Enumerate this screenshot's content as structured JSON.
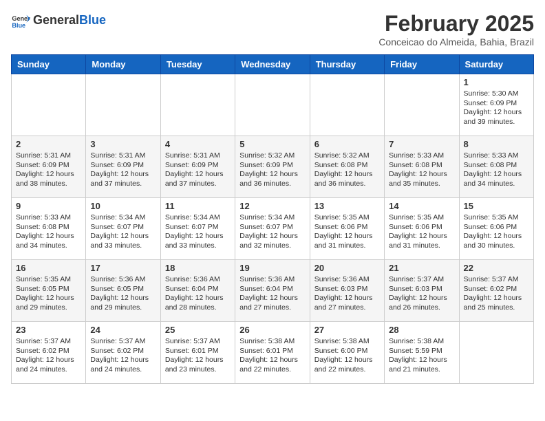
{
  "header": {
    "logo_general": "General",
    "logo_blue": "Blue",
    "month_title": "February 2025",
    "location": "Conceicao do Almeida, Bahia, Brazil"
  },
  "days_of_week": [
    "Sunday",
    "Monday",
    "Tuesday",
    "Wednesday",
    "Thursday",
    "Friday",
    "Saturday"
  ],
  "weeks": [
    [
      {
        "day": "",
        "info": ""
      },
      {
        "day": "",
        "info": ""
      },
      {
        "day": "",
        "info": ""
      },
      {
        "day": "",
        "info": ""
      },
      {
        "day": "",
        "info": ""
      },
      {
        "day": "",
        "info": ""
      },
      {
        "day": "1",
        "info": "Sunrise: 5:30 AM\nSunset: 6:09 PM\nDaylight: 12 hours and 39 minutes."
      }
    ],
    [
      {
        "day": "2",
        "info": "Sunrise: 5:31 AM\nSunset: 6:09 PM\nDaylight: 12 hours and 38 minutes."
      },
      {
        "day": "3",
        "info": "Sunrise: 5:31 AM\nSunset: 6:09 PM\nDaylight: 12 hours and 37 minutes."
      },
      {
        "day": "4",
        "info": "Sunrise: 5:31 AM\nSunset: 6:09 PM\nDaylight: 12 hours and 37 minutes."
      },
      {
        "day": "5",
        "info": "Sunrise: 5:32 AM\nSunset: 6:09 PM\nDaylight: 12 hours and 36 minutes."
      },
      {
        "day": "6",
        "info": "Sunrise: 5:32 AM\nSunset: 6:08 PM\nDaylight: 12 hours and 36 minutes."
      },
      {
        "day": "7",
        "info": "Sunrise: 5:33 AM\nSunset: 6:08 PM\nDaylight: 12 hours and 35 minutes."
      },
      {
        "day": "8",
        "info": "Sunrise: 5:33 AM\nSunset: 6:08 PM\nDaylight: 12 hours and 34 minutes."
      }
    ],
    [
      {
        "day": "9",
        "info": "Sunrise: 5:33 AM\nSunset: 6:08 PM\nDaylight: 12 hours and 34 minutes."
      },
      {
        "day": "10",
        "info": "Sunrise: 5:34 AM\nSunset: 6:07 PM\nDaylight: 12 hours and 33 minutes."
      },
      {
        "day": "11",
        "info": "Sunrise: 5:34 AM\nSunset: 6:07 PM\nDaylight: 12 hours and 33 minutes."
      },
      {
        "day": "12",
        "info": "Sunrise: 5:34 AM\nSunset: 6:07 PM\nDaylight: 12 hours and 32 minutes."
      },
      {
        "day": "13",
        "info": "Sunrise: 5:35 AM\nSunset: 6:06 PM\nDaylight: 12 hours and 31 minutes."
      },
      {
        "day": "14",
        "info": "Sunrise: 5:35 AM\nSunset: 6:06 PM\nDaylight: 12 hours and 31 minutes."
      },
      {
        "day": "15",
        "info": "Sunrise: 5:35 AM\nSunset: 6:06 PM\nDaylight: 12 hours and 30 minutes."
      }
    ],
    [
      {
        "day": "16",
        "info": "Sunrise: 5:35 AM\nSunset: 6:05 PM\nDaylight: 12 hours and 29 minutes."
      },
      {
        "day": "17",
        "info": "Sunrise: 5:36 AM\nSunset: 6:05 PM\nDaylight: 12 hours and 29 minutes."
      },
      {
        "day": "18",
        "info": "Sunrise: 5:36 AM\nSunset: 6:04 PM\nDaylight: 12 hours and 28 minutes."
      },
      {
        "day": "19",
        "info": "Sunrise: 5:36 AM\nSunset: 6:04 PM\nDaylight: 12 hours and 27 minutes."
      },
      {
        "day": "20",
        "info": "Sunrise: 5:36 AM\nSunset: 6:03 PM\nDaylight: 12 hours and 27 minutes."
      },
      {
        "day": "21",
        "info": "Sunrise: 5:37 AM\nSunset: 6:03 PM\nDaylight: 12 hours and 26 minutes."
      },
      {
        "day": "22",
        "info": "Sunrise: 5:37 AM\nSunset: 6:02 PM\nDaylight: 12 hours and 25 minutes."
      }
    ],
    [
      {
        "day": "23",
        "info": "Sunrise: 5:37 AM\nSunset: 6:02 PM\nDaylight: 12 hours and 24 minutes."
      },
      {
        "day": "24",
        "info": "Sunrise: 5:37 AM\nSunset: 6:02 PM\nDaylight: 12 hours and 24 minutes."
      },
      {
        "day": "25",
        "info": "Sunrise: 5:37 AM\nSunset: 6:01 PM\nDaylight: 12 hours and 23 minutes."
      },
      {
        "day": "26",
        "info": "Sunrise: 5:38 AM\nSunset: 6:01 PM\nDaylight: 12 hours and 22 minutes."
      },
      {
        "day": "27",
        "info": "Sunrise: 5:38 AM\nSunset: 6:00 PM\nDaylight: 12 hours and 22 minutes."
      },
      {
        "day": "28",
        "info": "Sunrise: 5:38 AM\nSunset: 5:59 PM\nDaylight: 12 hours and 21 minutes."
      },
      {
        "day": "",
        "info": ""
      }
    ]
  ]
}
